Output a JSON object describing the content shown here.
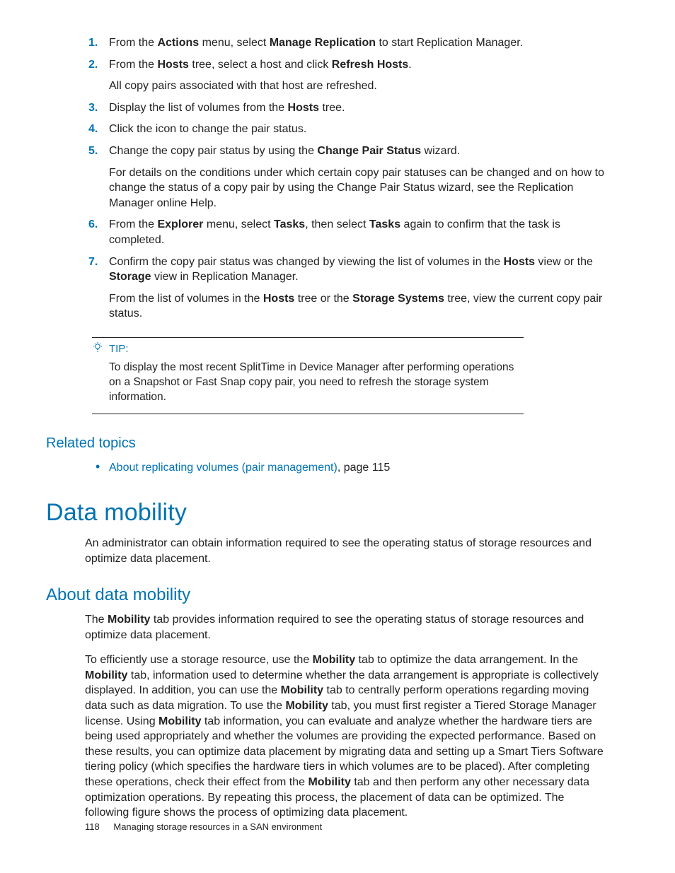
{
  "steps": [
    {
      "main": "From the <b>Actions</b> menu, select <b>Manage Replication</b> to start Replication Manager."
    },
    {
      "main": "From the <b>Hosts</b> tree, select a host and click <b>Refresh Hosts</b>.",
      "sub": "All copy pairs associated with that host are refreshed."
    },
    {
      "main": "Display the list of volumes from the <b>Hosts</b> tree."
    },
    {
      "main": "Click the icon to change the pair status."
    },
    {
      "main": "Change the copy pair status by using the <b>Change Pair Status</b> wizard.",
      "sub": "For details on the conditions under which certain copy pair statuses can be changed and on how to change the status of a copy pair by using the Change Pair Status wizard, see the Replication Manager online Help."
    },
    {
      "main": "From the <b>Explorer</b> menu, select <b>Tasks</b>, then select <b>Tasks</b> again to confirm that the task is completed."
    },
    {
      "main": "Confirm the copy pair status was changed by viewing the list of volumes in the <b>Hosts</b> view or the <b>Storage</b> view in Replication Manager.",
      "sub": "From the list of volumes in the <b>Hosts</b> tree or the <b>Storage Systems</b> tree, view the current copy pair status."
    }
  ],
  "tip": {
    "label": "TIP:",
    "body": "To display the most recent SplitTime in Device Manager after performing operations on a Snapshot or Fast Snap copy pair, you need to refresh the storage system information."
  },
  "related": {
    "heading": "Related topics",
    "link": "About replicating volumes (pair management)",
    "suffix": ", page 115"
  },
  "h1": "Data mobility",
  "intro": "An administrator can obtain information required to see the operating status of storage resources and optimize data placement.",
  "h2": "About data mobility",
  "p1": "The <b>Mobility</b> tab provides information required to see the operating status of storage resources and optimize data placement.",
  "p2": "To efficiently use a storage resource, use the <b>Mobility</b> tab to optimize the data arrangement. In the <b>Mobility</b> tab, information used to determine whether the data arrangement is appropriate is collectively displayed. In addition, you can use the <b>Mobility</b> tab to centrally perform operations regarding moving data such as data migration. To use the <b>Mobility</b> tab, you must first register a Tiered Storage Manager license. Using <b>Mobility</b> tab information, you can evaluate and analyze whether the hardware tiers are being used appropriately and whether the volumes are providing the expected performance. Based on these results, you can optimize data placement by migrating data and setting up a Smart Tiers Software tiering policy (which specifies the hardware tiers in which volumes are to be placed). After completing these operations, check their effect from the <b>Mobility</b> tab and then perform any other necessary data optimization operations. By repeating this process, the placement of data can be optimized. The following figure shows the process of optimizing data placement.",
  "footer": {
    "page": "118",
    "title": "Managing storage resources in a SAN environment"
  }
}
